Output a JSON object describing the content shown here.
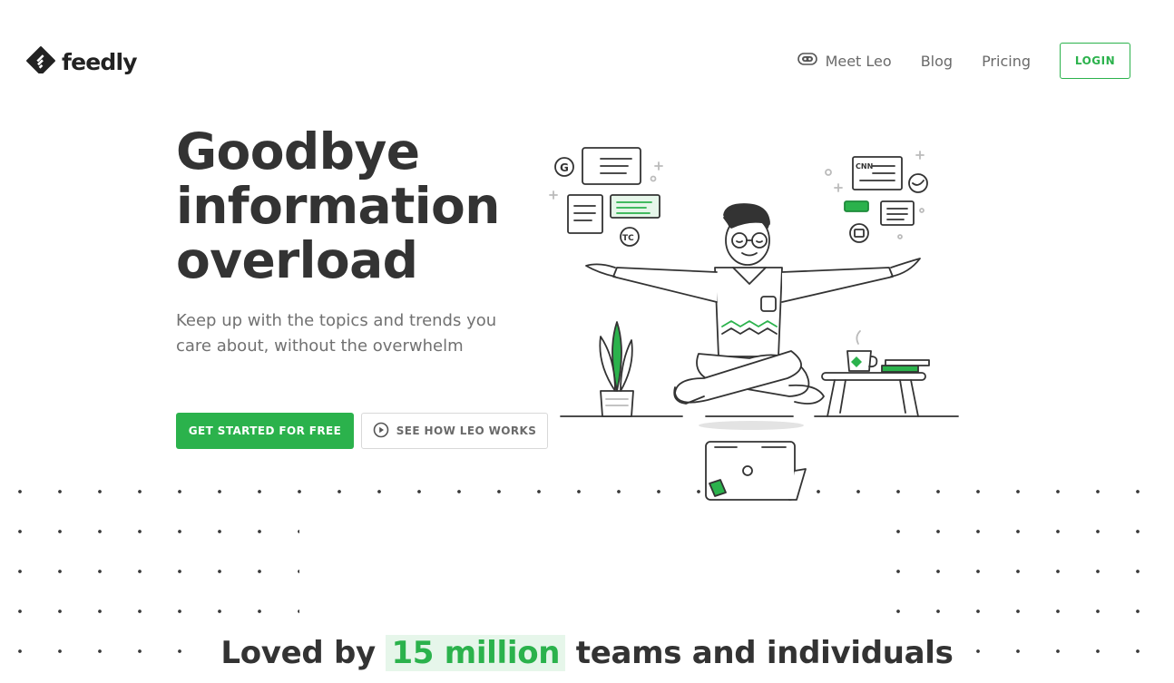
{
  "brand": {
    "name": "feedly",
    "accent": "#2bb24c"
  },
  "nav": {
    "meet_leo": "Meet Leo",
    "blog": "Blog",
    "pricing": "Pricing",
    "login": "LOGIN"
  },
  "hero": {
    "title_lines": [
      "Goodbye",
      "information",
      "overload"
    ],
    "subtitle": "Keep up with the topics and trends you care about, without the overwhelm",
    "cta_primary": "GET STARTED FOR FREE",
    "cta_secondary": "SEE HOW LEO WORKS"
  },
  "social_proof": {
    "prefix": "Loved by",
    "highlight": "15 million",
    "suffix": "teams and individuals"
  },
  "icons": [
    "feedly-logo-icon",
    "leo-robot-icon",
    "play-circle-icon"
  ]
}
